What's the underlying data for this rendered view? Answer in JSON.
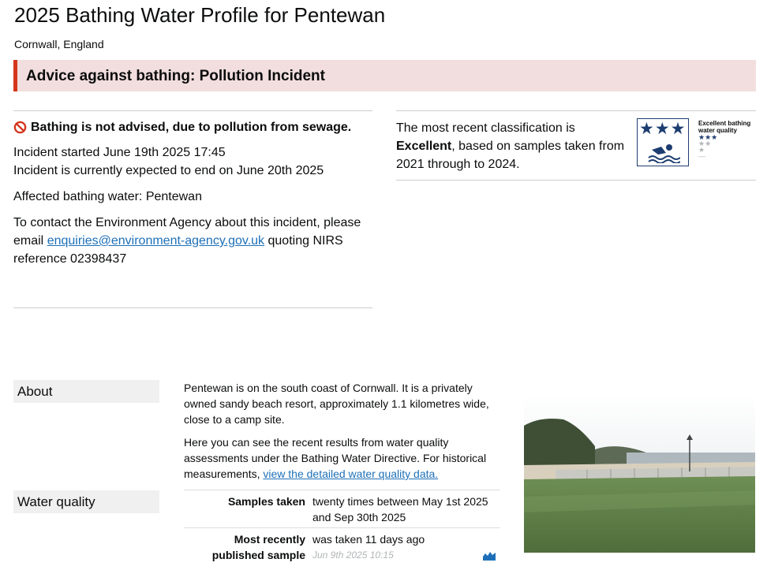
{
  "header": {
    "title": "2025 Bathing Water Profile for Pentewan",
    "subtitle": "Cornwall, England"
  },
  "banner": {
    "text": "Advice against bathing: Pollution Incident"
  },
  "incident": {
    "warning": "Bathing is not advised, due to pollution from sewage.",
    "started": "Incident started June 19th 2025 17:45",
    "expected_end": "Incident is currently expected to end on June 20th 2025",
    "affected": "Affected bathing water: Pentewan",
    "contact_pre": "To contact the Environment Agency about this incident, please email",
    "contact_email": "enquiries@environment-agency.gov.uk",
    "contact_post": "quoting NIRS reference 02398437"
  },
  "classification": {
    "text_pre": "The most recent classification is",
    "rating": "Excellent",
    "text_post": ", based on samples taken from 2021 through to 2024.",
    "badge_stars": "★★★",
    "legend_title": "Excellent bathing water quality",
    "legend_rows": [
      "★★★",
      "★★",
      "★",
      "—"
    ]
  },
  "about": {
    "label": "About",
    "p1": "Pentewan is on the south coast of Cornwall. It is a privately owned sandy beach resort, approximately 1.1 kilometres wide, close to a camp site.",
    "p2_pre": "Here you can see the recent results from water quality assessments under the Bathing Water Directive. For historical measurements,",
    "p2_link": "view the detailed water quality data."
  },
  "water_quality": {
    "label": "Water quality",
    "samples_key": "Samples taken",
    "samples_value": "twenty times between May 1st 2025 and Sep 30th 2025",
    "recent_key": "Most recently published sample",
    "recent_value": "was taken 11 days ago",
    "recent_timestamp": "Jun 9th 2025 10:15"
  },
  "colors": {
    "accent_red": "#d4351c",
    "banner_bg": "#f2dede",
    "link": "#1d70b8",
    "badge_blue": "#1d3d71"
  }
}
